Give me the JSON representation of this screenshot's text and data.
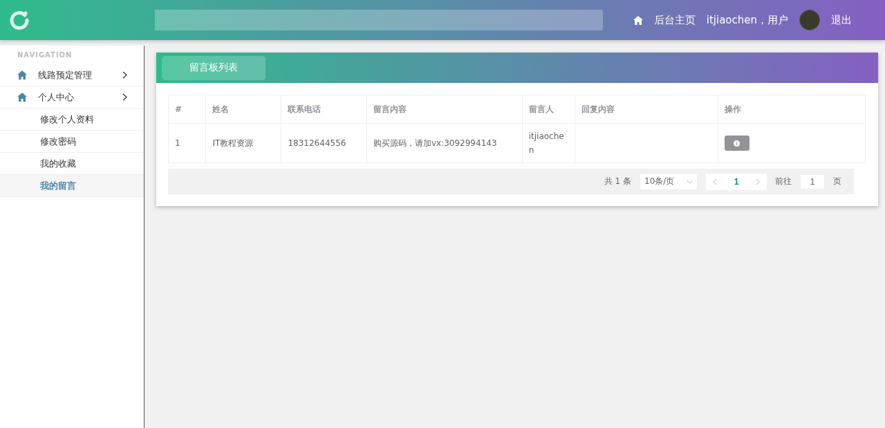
{
  "header": {
    "nav_link": "后台主页",
    "user_greeting": "itjiaochen，用户",
    "logout": "退出"
  },
  "sidebar": {
    "heading": "NAVIGATION",
    "items": [
      {
        "label": "线路预定管理"
      },
      {
        "label": "个人中心",
        "children": [
          {
            "label": "修改个人资料",
            "selected": false
          },
          {
            "label": "修改密码",
            "selected": false
          },
          {
            "label": "我的收藏",
            "selected": false
          },
          {
            "label": "我的留言",
            "selected": true
          }
        ]
      }
    ]
  },
  "panel": {
    "title": "留言板列表"
  },
  "table": {
    "columns": [
      "#",
      "姓名",
      "联系电话",
      "留言内容",
      "留言人",
      "回复内容",
      "操作"
    ],
    "rows": [
      {
        "cells": [
          "1",
          "IT教程资源",
          "18312644556",
          "购买源码，请加vx:3092994143",
          "itjiaochen",
          ""
        ]
      }
    ]
  },
  "pagination": {
    "total": "共 1 条",
    "page_size": "10条/页",
    "current_page": "1",
    "goto_label": "前往",
    "goto_value": "1",
    "page_suffix": "页"
  }
}
